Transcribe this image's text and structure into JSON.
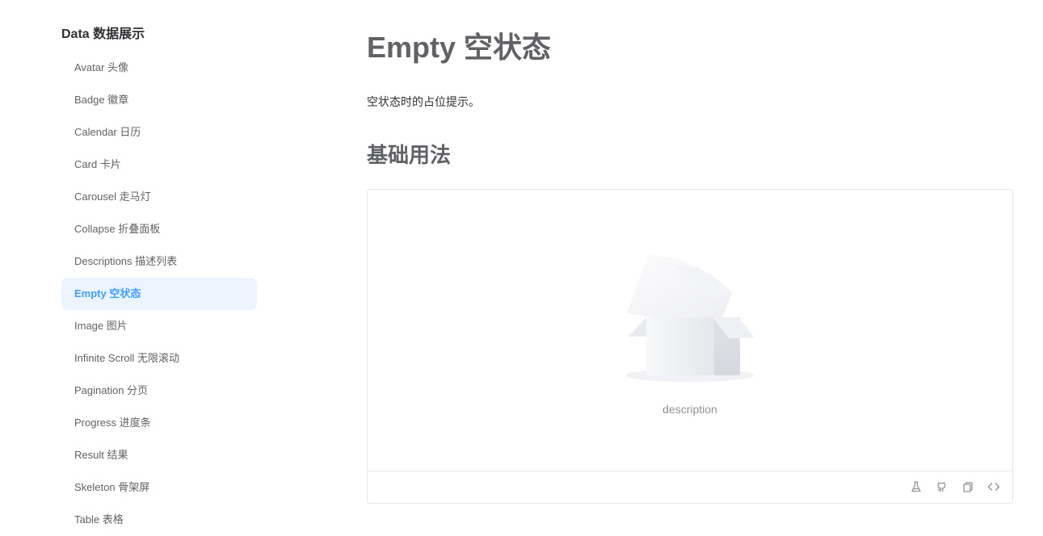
{
  "sidebar": {
    "group_title": "Data 数据展示",
    "items": [
      {
        "label": "Avatar 头像"
      },
      {
        "label": "Badge 徽章"
      },
      {
        "label": "Calendar 日历"
      },
      {
        "label": "Card 卡片"
      },
      {
        "label": "Carousel 走马灯"
      },
      {
        "label": "Collapse 折叠面板"
      },
      {
        "label": "Descriptions 描述列表"
      },
      {
        "label": "Empty 空状态"
      },
      {
        "label": "Image 图片"
      },
      {
        "label": "Infinite Scroll 无限滚动"
      },
      {
        "label": "Pagination 分页"
      },
      {
        "label": "Progress 进度条"
      },
      {
        "label": "Result 结果"
      },
      {
        "label": "Skeleton 骨架屏"
      },
      {
        "label": "Table 表格"
      }
    ],
    "active_item": "Empty 空状态"
  },
  "main": {
    "title": "Empty 空状态",
    "description": "空状态时的占位提示。",
    "section_title": "基础用法",
    "demo": {
      "empty_description": "description",
      "footer_icons": [
        "playground-flask-icon",
        "github-icon",
        "copy-icon",
        "code-icon"
      ]
    }
  },
  "colors": {
    "accent": "#409eff",
    "active_bg": "#ecf5ff",
    "border": "#e4e7ed",
    "muted_text": "#909399"
  }
}
